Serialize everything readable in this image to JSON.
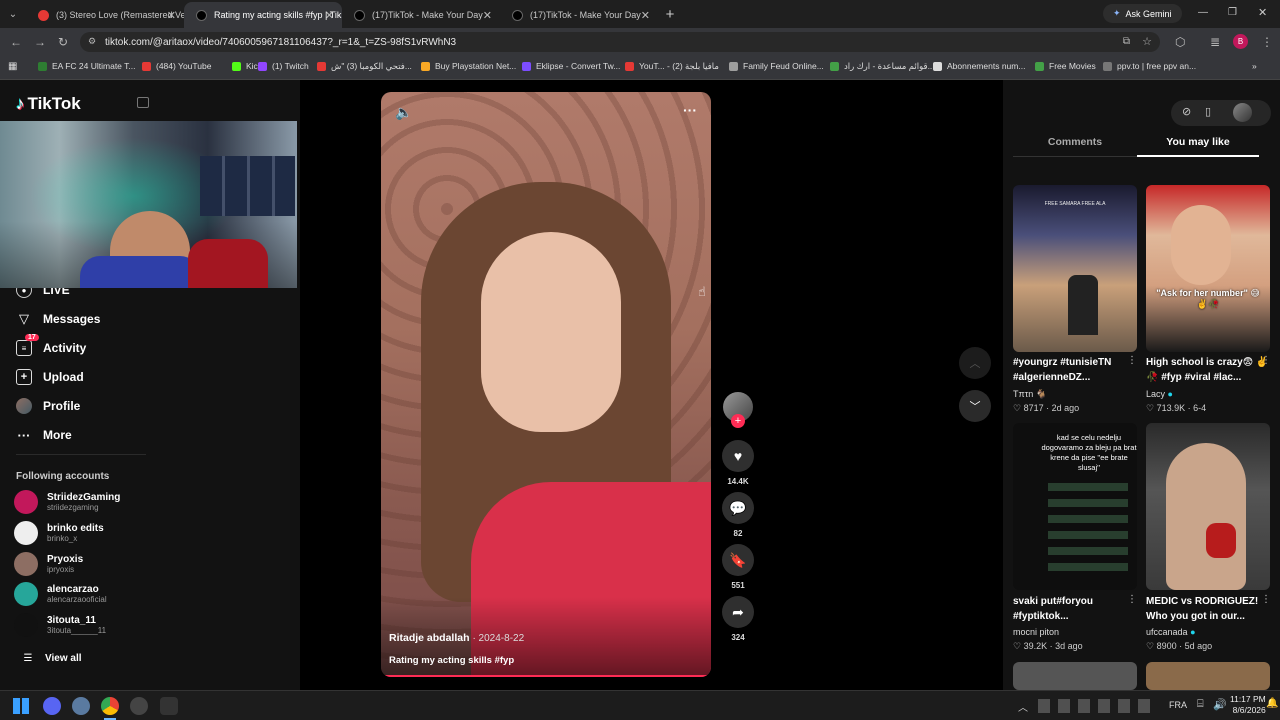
{
  "browser": {
    "tabs": [
      {
        "title": "(3) Stereo Love (Remastered Ve",
        "fav": "#e53935"
      },
      {
        "title": "Rating my acting skills #fyp | Tik",
        "fav": "#000000",
        "active": true
      },
      {
        "title": "(17)TikTok - Make Your Day",
        "fav": "#000000"
      },
      {
        "title": "(17)TikTok - Make Your Day",
        "fav": "#000000"
      }
    ],
    "url": "tiktok.com/@aritaox/video/7406005967181106437?_r=1&_t=ZS-98fS1vRWhN3",
    "ask_gemini": "Ask Gemini",
    "profile_letter": "B",
    "bookmarks": [
      {
        "label": "EA FC 24 Ultimate T...",
        "color": "#2e7d32"
      },
      {
        "label": "(484) YouTube",
        "color": "#e53935"
      },
      {
        "label": "Kick",
        "color": "#53fc18"
      },
      {
        "label": "(1) Twitch",
        "color": "#9146ff"
      },
      {
        "label": "فتحي الكومبا (3) \"ش...",
        "color": "#e53935"
      },
      {
        "label": "Buy Playstation Net...",
        "color": "#f9a825"
      },
      {
        "label": "Eklipse - Convert Tw...",
        "color": "#7c4dff"
      },
      {
        "label": "YouT... - مافيا بلجة (2)",
        "color": "#e53935"
      },
      {
        "label": "Family Feud Online...",
        "color": "#9e9e9e"
      },
      {
        "label": "قوائم مساعدة - ارك راد...",
        "color": "#43a047"
      },
      {
        "label": "Abonnements num...",
        "color": "#ddd"
      },
      {
        "label": "Free Movies",
        "color": "#43a047"
      },
      {
        "label": "ppv.to | free ppv an...",
        "color": "#777"
      }
    ]
  },
  "tiktok": {
    "logo": "TikTok",
    "nav": [
      {
        "label": "LIVE",
        "icon": "live-icon"
      },
      {
        "label": "Messages",
        "icon": "messages-icon"
      },
      {
        "label": "Activity",
        "icon": "activity-icon",
        "badge": "17"
      },
      {
        "label": "Upload",
        "icon": "upload-icon"
      },
      {
        "label": "Profile",
        "icon": "profile-icon"
      },
      {
        "label": "More",
        "icon": "more-icon"
      }
    ],
    "following_title": "Following accounts",
    "following": [
      {
        "name": "StriidezGaming",
        "handle": "striidezgaming",
        "color": "#c2185b"
      },
      {
        "name": "brinko edits",
        "handle": "brinko_x",
        "color": "#eeeeee"
      },
      {
        "name": "Pryoxis",
        "handle": "ipryoxis",
        "color": "#8d6e63"
      },
      {
        "name": "alencarzao",
        "handle": "alencarzaooficial",
        "color": "#26a69a"
      },
      {
        "name": "3itouta_11",
        "handle": "3itouta______11",
        "color": "#111111"
      }
    ],
    "view_all": "View all"
  },
  "video": {
    "author": "Ritadje abdallah",
    "date": "· 2024-8-22",
    "caption": "Rating my acting skills #fyp",
    "likes": "14.4K",
    "comments": "82",
    "saves": "551",
    "shares": "324"
  },
  "panel": {
    "tab_comments": "Comments",
    "tab_you_may_like": "You may like",
    "items": [
      {
        "caption": "#youngrz #tunisieTN #algerienneDZ...",
        "author": "Tπτn 🐐",
        "likes": "8717",
        "age": "· 2d ago",
        "overlay": "FREE SAMARA FREE ALA"
      },
      {
        "caption": "High school is crazy😨 ✌️🥀 #fyp #viral #lac...",
        "author": "Lacy",
        "likes": "713.9K",
        "age": "· 6-4",
        "overlay": "\"Ask for her number\" 😅✌️🥀"
      },
      {
        "caption": "svaki put#foryou #fyptiktok...",
        "author": "mocni piton",
        "likes": "39.2K",
        "age": "· 3d ago",
        "overlay": "kad se celu nedelju dogovaramo za bleju pa brat krene da pise ''ee brate slusaj''"
      },
      {
        "caption": "MEDIC vs RODRIGUEZ! Who you got in our...",
        "author": "ufccanada",
        "likes": "8900",
        "age": "· 5d ago",
        "overlay": ""
      }
    ]
  },
  "taskbar": {
    "lang": "FRA",
    "time": "11:17 PM",
    "date": "8/6/2026"
  }
}
